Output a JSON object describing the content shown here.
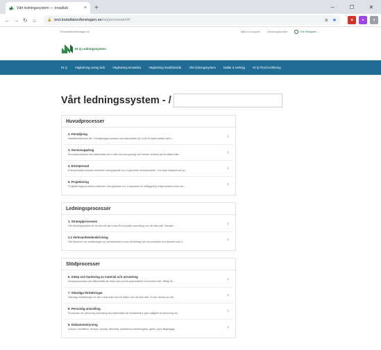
{
  "browser": {
    "tab_title": "Vårt ledningssystem — Installati",
    "tab_close": "×",
    "new_tab": "+",
    "url_host": "test.installatorsforetagen.se",
    "url_path": "/ivq/processer/#/",
    "window_min": "–",
    "window_max": "☐"
  },
  "topline": {
    "left": "Till installatorsföretagen.se",
    "support": "Hjälp och support",
    "language": "Lämna synpunkter",
    "login": "Elof Strängnes"
  },
  "logo": {
    "text": "IN Q Ledningssystem"
  },
  "nav": {
    "items": [
      "IN Q",
      "Vägledning ovntig sida",
      "Vägledning tematiska",
      "Vägledning handboksida",
      "Vårt ledningssystem",
      "Mallar & Verktyg",
      "IN Q Plus/Certifiering"
    ]
  },
  "page": {
    "title": "Vårt ledningssystem - /"
  },
  "sections": [
    {
      "title": "Huvudprocesser",
      "items": [
        {
          "title": "2. Försäljning",
          "desc": "Installbesöknmad AB: Försäljningsprocessen ska säkerställa att vi på ett systematiskt sätt s..."
        },
        {
          "title": "3. Serviceuppdrag",
          "desc": "Serviceprocessen ska säkerställa att vi utför serviceuppdrag och mindre arbeten på ett säkert sätt,..."
        },
        {
          "title": "4. Entreprenad",
          "desc": "Entreprenadprocessen beskriver övergripande hur vi genomför entreprenader. Vid varje entreprenad sp..."
        },
        {
          "title": "5. Projektering",
          "desc": "Projekteringsprocessen beskriver övergripande hur vi anpassar en anläggning enligt kunders krav och..."
        }
      ]
    },
    {
      "title": "Ledningsprocesser",
      "items": [
        {
          "title": "1. Strategiprocessen",
          "desc": "Vårt ledningssystem är ett stöd för att vi ska få en positiv utveckling och nå våra mål. Samaid ..."
        },
        {
          "title": "1.1 Verksamhetsbeskrivning",
          "desc": "Här beskriver du omfattningen av verksamheten mom ett företag och de produkter och tjänster som n..."
        }
      ]
    },
    {
      "title": "Stödprocesser",
      "items": [
        {
          "title": "6. Inköp och hantering av material och utrustning",
          "desc": "Inköpsprocessen ska säkerställa att inköp sker på ett systematiskt och korrekt sätt. Viktigt för ..."
        },
        {
          "title": "7. Ständiga förbättringar",
          "desc": "Ständiga förbättringar för att vi hela tiden ska bli bättre och nå våra mål. Vi drar lärdom av vår..."
        },
        {
          "title": "8. Personlig utveckling",
          "desc": "Processen för personlig utveckling ska säkerställa att medarbetare ges möjlighet till personlig utv..."
        },
        {
          "title": "9. Dokumentstyrning",
          "desc": "Ledord: Identifiera, förvara, skydda, återsöka, bestämma arkiveringstid, gallra, göra tillgängligt..."
        }
      ]
    }
  ]
}
